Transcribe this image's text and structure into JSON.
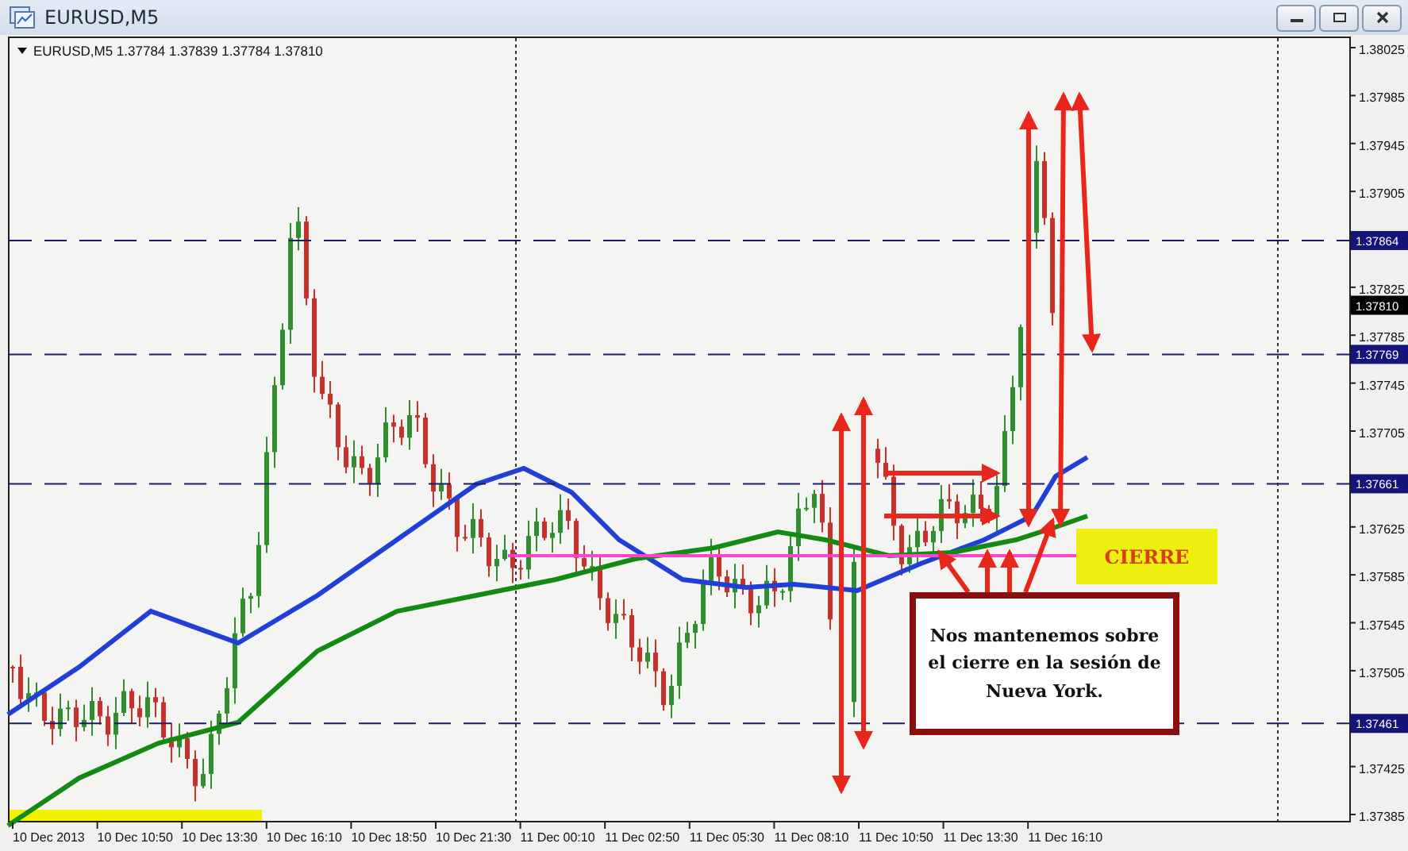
{
  "window": {
    "title": "EURUSD,M5"
  },
  "legend": {
    "symbol": "EURUSD,M5",
    "values": "1.37784 1.37839 1.37784 1.37810"
  },
  "price_axis": [
    "1.38025",
    "1.37985",
    "1.37945",
    "1.37905",
    "1.37825",
    "1.37785",
    "1.37745",
    "1.37705",
    "1.37625",
    "1.37585",
    "1.37545",
    "1.37505",
    "1.37425",
    "1.37385"
  ],
  "price_markers": [
    {
      "kind": "level",
      "label": "1.37864"
    },
    {
      "kind": "current",
      "label": "1.37810"
    },
    {
      "kind": "level",
      "label": "1.37769"
    },
    {
      "kind": "level",
      "label": "1.37661"
    },
    {
      "kind": "level",
      "label": "1.37461"
    }
  ],
  "time_axis": [
    "10 Dec 2013",
    "10 Dec 10:50",
    "10 Dec 13:30",
    "10 Dec 16:10",
    "10 Dec 18:50",
    "10 Dec 21:30",
    "11 Dec 00:10",
    "11 Dec 02:50",
    "11 Dec 05:30",
    "11 Dec 08:10",
    "11 Dec 10:50",
    "11 Dec 13:30",
    "11 Dec 16:10"
  ],
  "annotations": {
    "label": "CIERRE",
    "note": "Nos mantenemos sobre el cierre en la sesión de Nueva York."
  }
}
